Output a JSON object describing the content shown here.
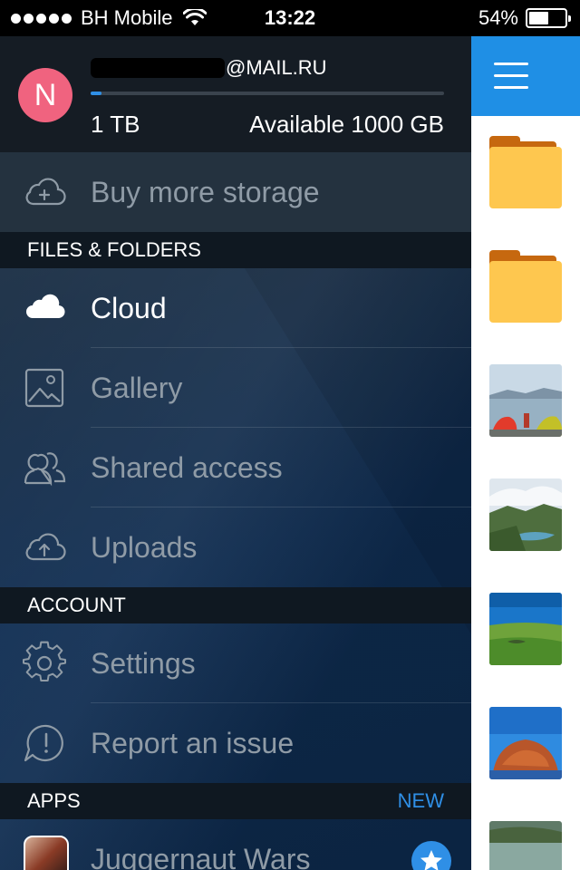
{
  "status_bar": {
    "carrier": "BH Mobile",
    "time": "13:22",
    "battery": "54%",
    "battery_level": 0.54,
    "signal_bars": 5
  },
  "account": {
    "avatar_letter": "N",
    "email_domain": "@MAIL.RU",
    "quota_total": "1 TB",
    "quota_available": "Available 1000 GB",
    "usage_fraction": 0.03
  },
  "buy_storage": {
    "label": "Buy more storage",
    "icon": "cloud-plus-icon"
  },
  "sections": {
    "files_folders": "FILES & FOLDERS",
    "account": "ACCOUNT",
    "apps": "APPS",
    "apps_badge": "NEW"
  },
  "nav": {
    "cloud": {
      "label": "Cloud",
      "icon": "cloud-icon"
    },
    "gallery": {
      "label": "Gallery",
      "icon": "image-icon"
    },
    "shared": {
      "label": "Shared access",
      "icon": "people-icon"
    },
    "uploads": {
      "label": "Uploads",
      "icon": "cloud-upload-icon"
    },
    "settings": {
      "label": "Settings",
      "icon": "gear-icon"
    },
    "report": {
      "label": "Report an issue",
      "icon": "alert-icon"
    }
  },
  "apps": {
    "juggernaut": {
      "label": "Juggernaut Wars",
      "icon": "star-icon"
    }
  },
  "colors": {
    "accent": "#2f8fe6",
    "avatar": "#f0637f",
    "folder": "#fec74f"
  }
}
